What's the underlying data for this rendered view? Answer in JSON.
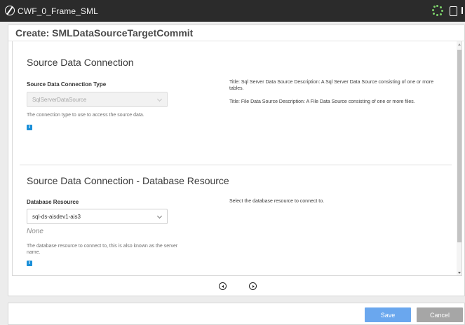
{
  "window": {
    "title": "CWF_0_Frame_SML",
    "icons": [
      "app-logo-icon",
      "loading-spinner-icon",
      "clipboard-icon",
      "menu-icon"
    ]
  },
  "dialog": {
    "title": "Create: SMLDataSourceTargetCommit"
  },
  "section_source": {
    "heading": "Source Data Connection",
    "field_label": "Source Data Connection Type",
    "select_value": "SqlServerDataSource",
    "select_disabled": true,
    "helper_text": "The connection type to use to access the source data.",
    "descriptions": [
      "Title: Sql Server Data Source Description: A Sql Server Data Source consisting of one or more tables.",
      "Title: File Data Source Description: A File Data Source consisting of one or more files."
    ]
  },
  "section_database": {
    "heading": "Source Data Connection - Database Resource",
    "field_label": "Database Resource",
    "select_value": "sql-ds-aisdev1-ais3",
    "none_text": "None",
    "helper_text": "The database resource to connect to, this is also known as the server name.",
    "description": "Select the database resource to connect to."
  },
  "footer": {
    "save_label": "Save",
    "cancel_label": "Cancel"
  },
  "colors": {
    "titlebar": "#2b2b2b",
    "accent_info": "#1a8fd8",
    "save_button": "#6aa7ee",
    "cancel_button": "#a6a6a6"
  }
}
